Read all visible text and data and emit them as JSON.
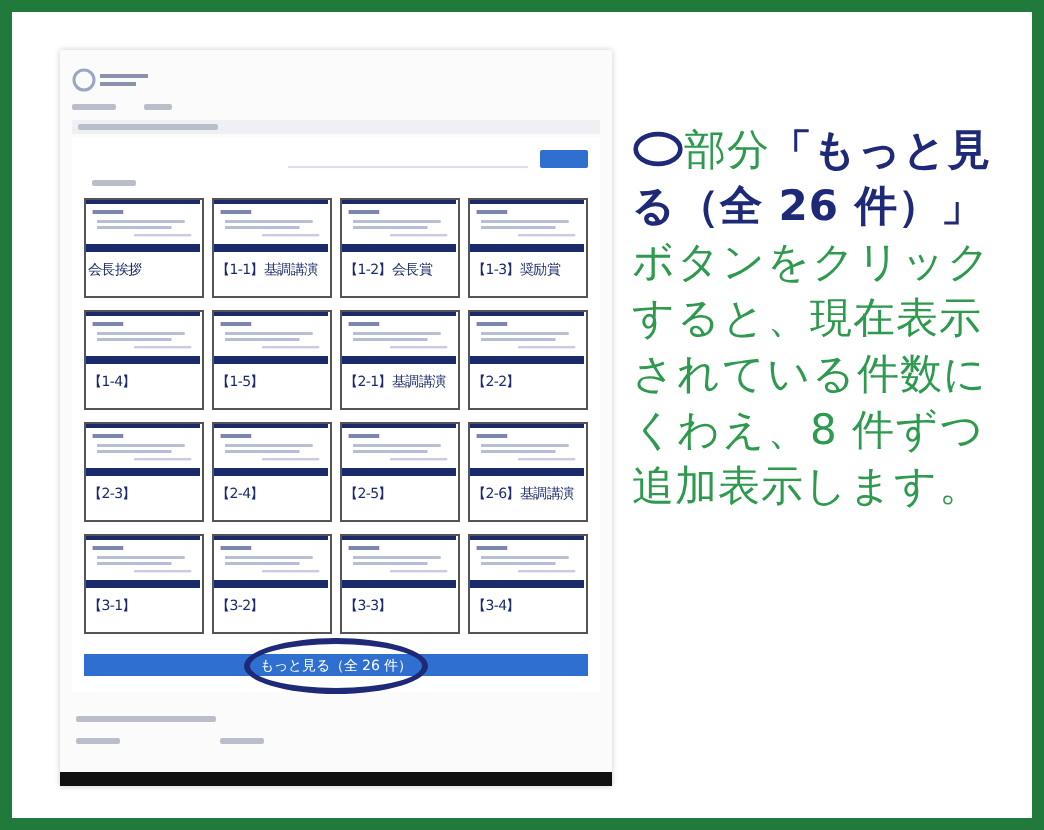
{
  "screenshot": {
    "cards": [
      {
        "caption": "会長挨拶"
      },
      {
        "caption": "【1-1】基調講演"
      },
      {
        "caption": "【1-2】会長賞"
      },
      {
        "caption": "【1-3】奨励賞"
      },
      {
        "caption": "【1-4】"
      },
      {
        "caption": "【1-5】"
      },
      {
        "caption": "【2-1】基調講演"
      },
      {
        "caption": "【2-2】"
      },
      {
        "caption": "【2-3】"
      },
      {
        "caption": "【2-4】"
      },
      {
        "caption": "【2-5】"
      },
      {
        "caption": "【2-6】基調講演"
      },
      {
        "caption": "【3-1】"
      },
      {
        "caption": "【3-2】"
      },
      {
        "caption": "【3-3】"
      },
      {
        "caption": "【3-4】"
      }
    ],
    "more_button": {
      "label": "もっと見る（全 26 件）",
      "highlighted": true
    }
  },
  "callout": {
    "segments": [
      {
        "text": "部分",
        "emphasis": false
      },
      {
        "text": "「もっと見る（全 26 件）」",
        "emphasis": true
      },
      {
        "text": "ボタンをクリックすると、現在表示されている件数にくわえ、8 件ずつ追加表示します。",
        "emphasis": false
      }
    ]
  }
}
